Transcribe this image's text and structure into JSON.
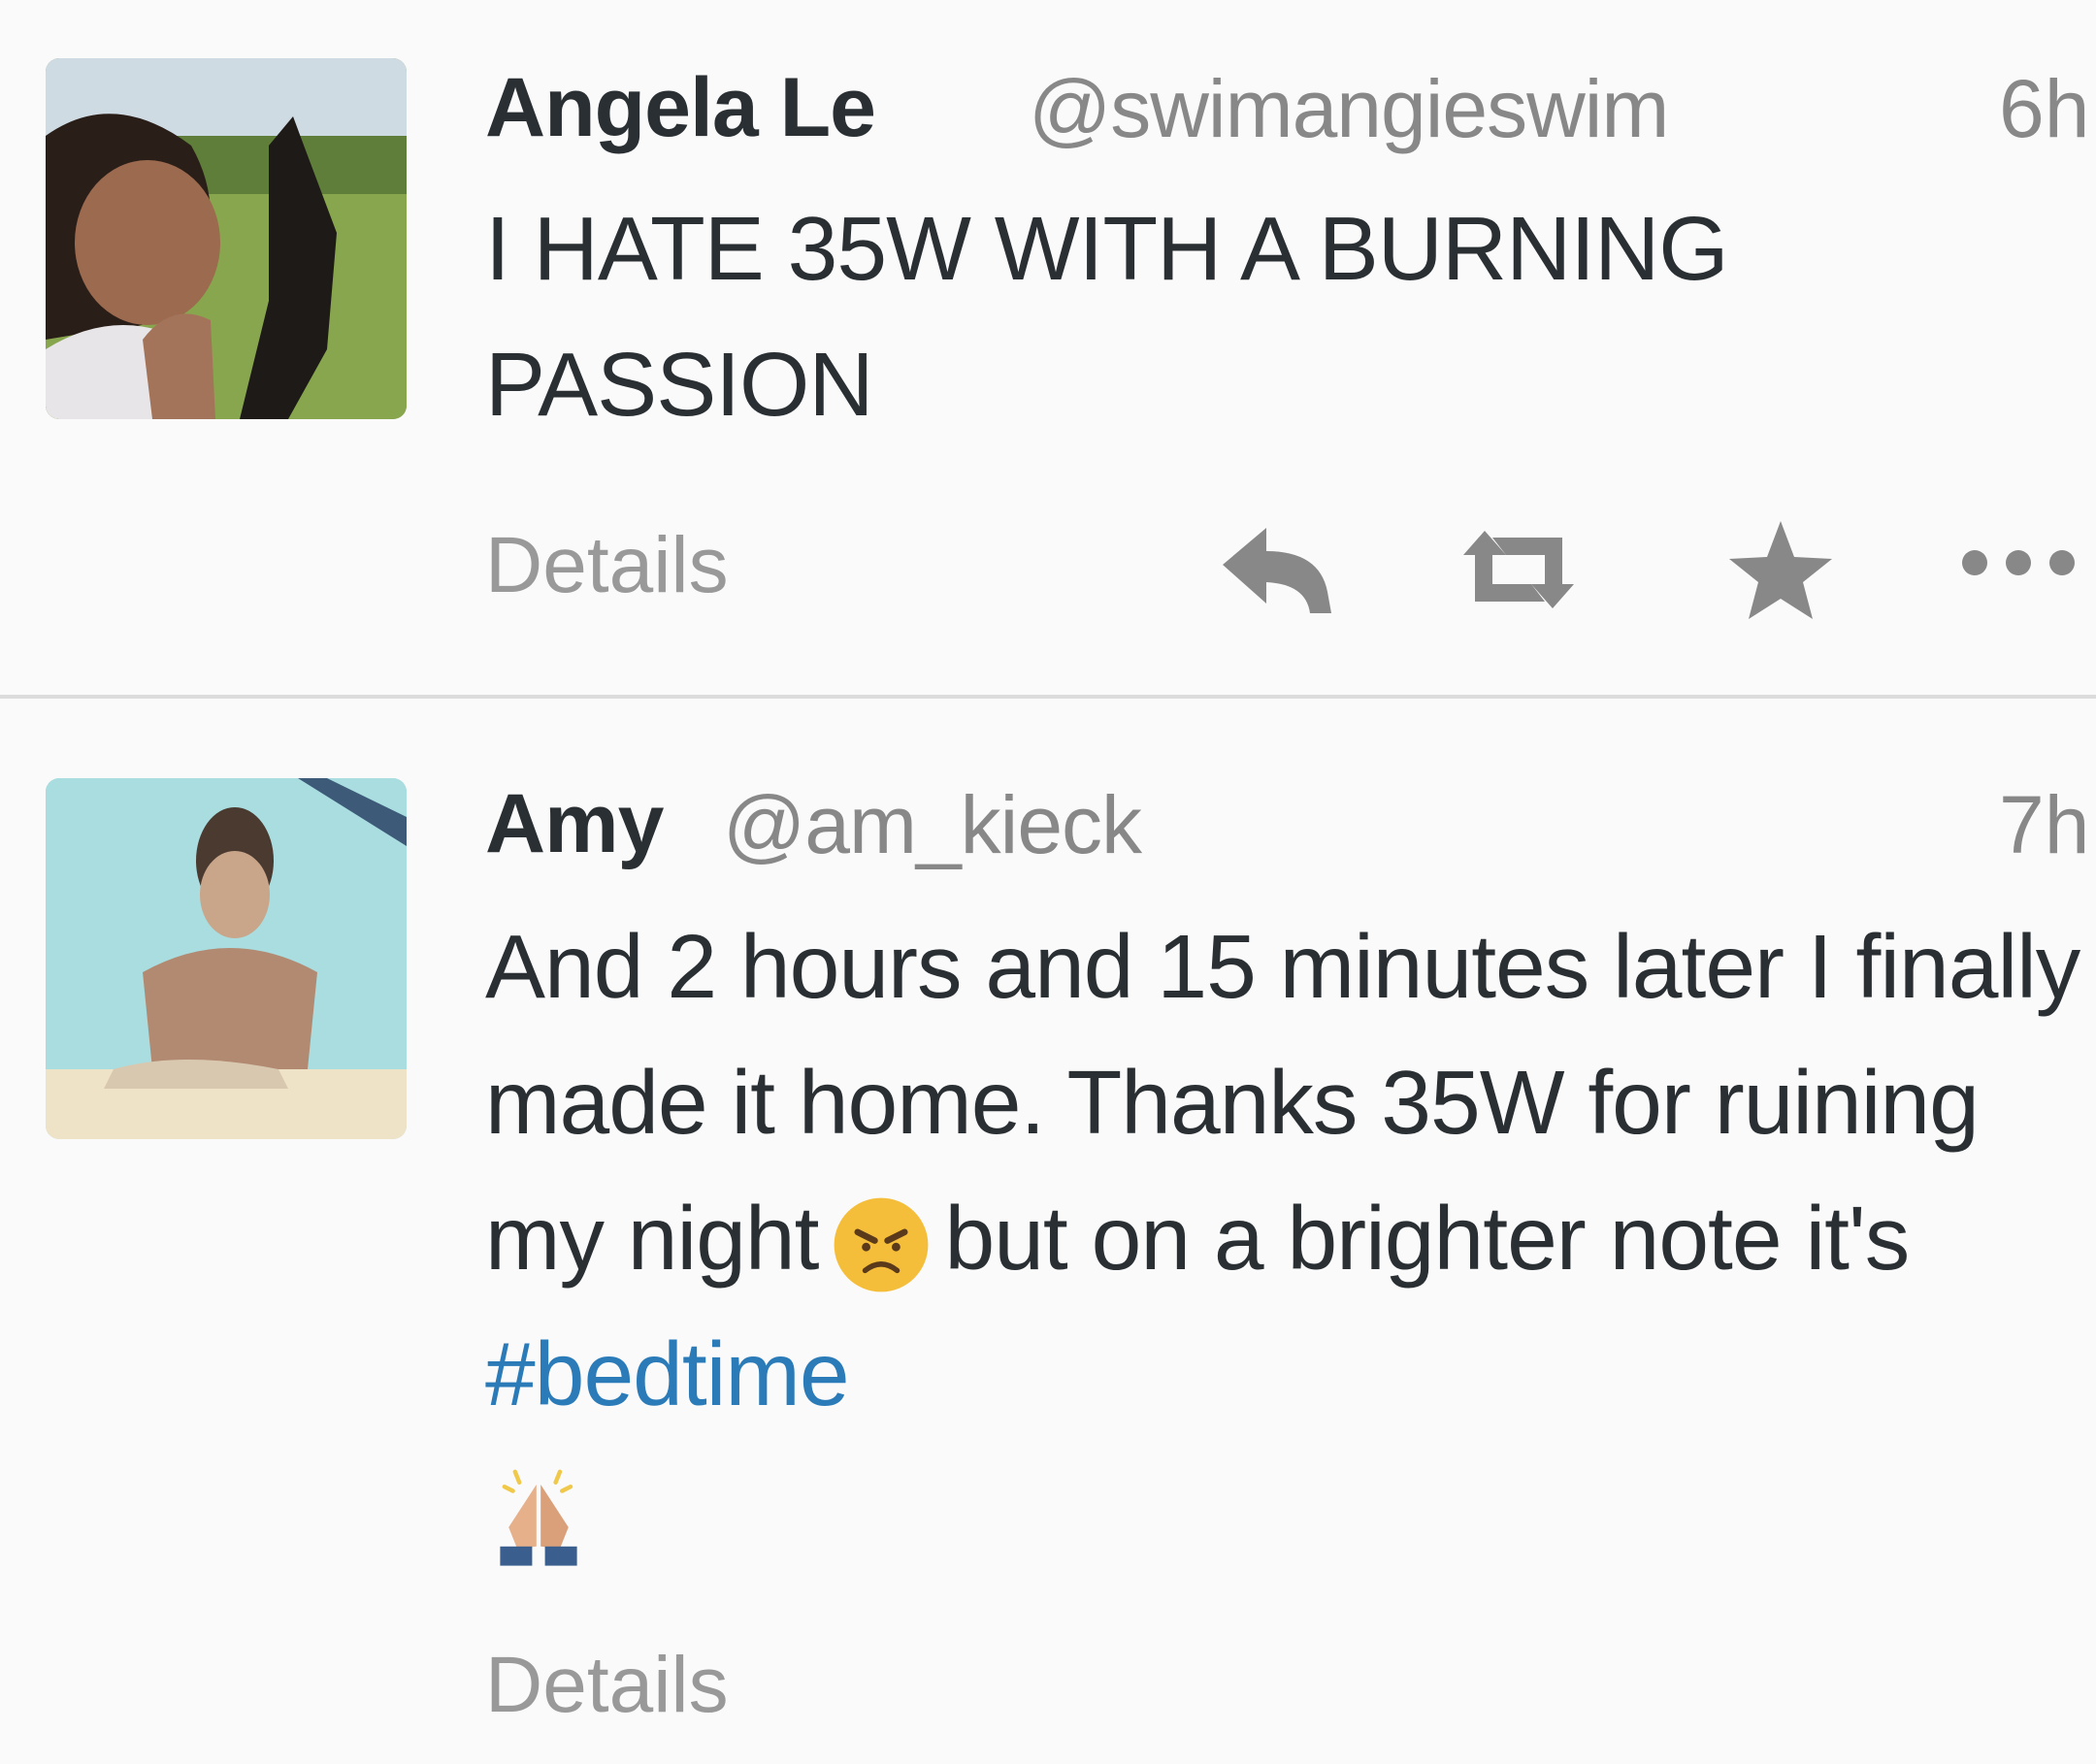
{
  "tweets": [
    {
      "fullname": "Angela Le",
      "username": "@swimangieswim",
      "timestamp": "6h",
      "text": "I HATE 35W WITH A BURNING PASSION",
      "details_label": "Details",
      "actions": [
        "reply-icon",
        "retweet-icon",
        "favorite-icon",
        "more-icon"
      ]
    },
    {
      "fullname": "Amy",
      "username": "@am_kieck",
      "timestamp": "7h",
      "text_parts": {
        "part1": "And 2 hours and 15 minutes later I finally made it home. Thanks 35W for ruining my night",
        "emoji1": "angry-face-emoji",
        "part2": "but on a brighter note it's",
        "hashtag": "#bedtime",
        "emoji2": "praying-hands-emoji"
      },
      "details_label": "Details"
    }
  ],
  "colors": {
    "background": "#fafafa",
    "text": "#292f33",
    "muted": "#999999",
    "hashtag": "#2b7bb9",
    "divider": "#dcdcdc"
  }
}
